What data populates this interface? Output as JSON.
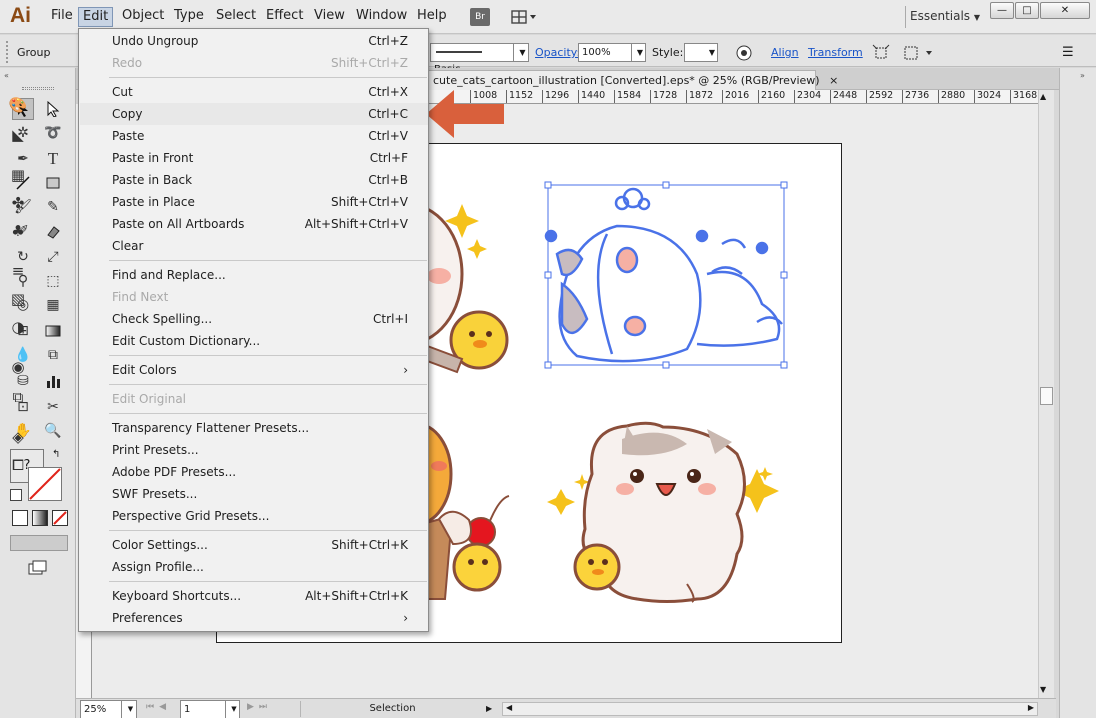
{
  "app": {
    "logo": "Ai"
  },
  "menubar": {
    "items": [
      "File",
      "Edit",
      "Object",
      "Type",
      "Select",
      "Effect",
      "View",
      "Window",
      "Help"
    ],
    "bridge_label": "Br",
    "workspace": "Essentials"
  },
  "controlbar": {
    "selection_label": "Group",
    "stroke_profile": "Basic",
    "opacity_label": "Opacity:",
    "opacity_value": "100%",
    "style_label": "Style:",
    "align_label": "Align",
    "transform_label": "Transform"
  },
  "document": {
    "tab_title": "cute_cats_cartoon_illustration [Converted].eps* @ 25% (RGB/Preview)",
    "ruler_ticks": [
      "1008",
      "1152",
      "1296",
      "1440",
      "1584",
      "1728",
      "1872",
      "2016",
      "2160",
      "2304",
      "2448",
      "2592",
      "2736",
      "2880",
      "3024",
      "3168"
    ]
  },
  "status": {
    "zoom": "25%",
    "artboard": "1",
    "tool": "Selection"
  },
  "edit_menu": {
    "groups": [
      [
        {
          "label": "Undo Ungroup",
          "shortcut": "Ctrl+Z",
          "disabled": false
        },
        {
          "label": "Redo",
          "shortcut": "Shift+Ctrl+Z",
          "disabled": true
        }
      ],
      [
        {
          "label": "Cut",
          "shortcut": "Ctrl+X",
          "disabled": false
        },
        {
          "label": "Copy",
          "shortcut": "Ctrl+C",
          "disabled": false,
          "highlighted": true
        },
        {
          "label": "Paste",
          "shortcut": "Ctrl+V",
          "disabled": false
        },
        {
          "label": "Paste in Front",
          "shortcut": "Ctrl+F",
          "disabled": false
        },
        {
          "label": "Paste in Back",
          "shortcut": "Ctrl+B",
          "disabled": false
        },
        {
          "label": "Paste in Place",
          "shortcut": "Shift+Ctrl+V",
          "disabled": false
        },
        {
          "label": "Paste on All Artboards",
          "shortcut": "Alt+Shift+Ctrl+V",
          "disabled": false
        },
        {
          "label": "Clear",
          "shortcut": "",
          "disabled": false
        }
      ],
      [
        {
          "label": "Find and Replace...",
          "shortcut": "",
          "disabled": false
        },
        {
          "label": "Find Next",
          "shortcut": "",
          "disabled": true
        },
        {
          "label": "Check Spelling...",
          "shortcut": "Ctrl+I",
          "disabled": false
        },
        {
          "label": "Edit Custom Dictionary...",
          "shortcut": "",
          "disabled": false
        }
      ],
      [
        {
          "label": "Edit Colors",
          "shortcut": "›",
          "disabled": false
        }
      ],
      [
        {
          "label": "Edit Original",
          "shortcut": "",
          "disabled": true
        }
      ],
      [
        {
          "label": "Transparency Flattener Presets...",
          "shortcut": "",
          "disabled": false
        },
        {
          "label": "Print Presets...",
          "shortcut": "",
          "disabled": false
        },
        {
          "label": "Adobe PDF Presets...",
          "shortcut": "",
          "disabled": false
        },
        {
          "label": "SWF Presets...",
          "shortcut": "",
          "disabled": false
        },
        {
          "label": "Perspective Grid Presets...",
          "shortcut": "",
          "disabled": false
        }
      ],
      [
        {
          "label": "Color Settings...",
          "shortcut": "Shift+Ctrl+K",
          "disabled": false
        },
        {
          "label": "Assign Profile...",
          "shortcut": "",
          "disabled": false
        }
      ],
      [
        {
          "label": "Keyboard Shortcuts...",
          "shortcut": "Alt+Shift+Ctrl+K",
          "disabled": false
        },
        {
          "label": "Preferences",
          "shortcut": "›",
          "disabled": false
        }
      ]
    ]
  },
  "tools": {
    "unknown_label": "?"
  },
  "colors": {
    "accent_arrow": "#d9603c",
    "selection": "#4a72e8",
    "menu_highlight": "#e8e8e8"
  }
}
